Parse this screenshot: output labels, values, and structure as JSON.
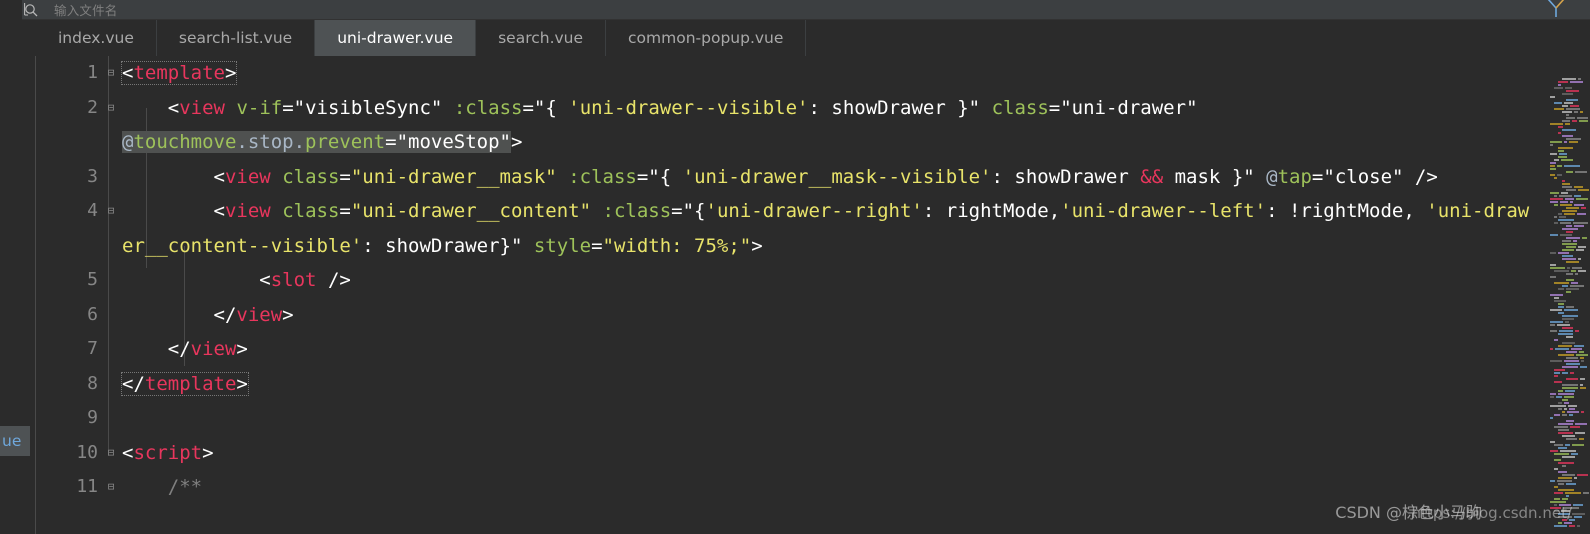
{
  "window": {
    "theme_bg": "#2b2b2b",
    "chrome_bg": "#3c3f41",
    "accent_tag": "#e8365d",
    "accent_attr": "#9ec25a",
    "accent_string": "#e8e36a",
    "active_tab_bg": "#4e5254"
  },
  "search": {
    "icon": "search-icon",
    "placeholder": "输入文件名",
    "value": ""
  },
  "tabs": [
    {
      "label": "index.vue",
      "active": false
    },
    {
      "label": "search-list.vue",
      "active": false
    },
    {
      "label": "uni-drawer.vue",
      "active": true
    },
    {
      "label": "search.vue",
      "active": false
    },
    {
      "label": "common-popup.vue",
      "active": false
    }
  ],
  "editor": {
    "language": "vue",
    "line_numbers": [
      "1",
      "2",
      "3",
      "4",
      "5",
      "6",
      "7",
      "8",
      "9",
      "10",
      "11"
    ],
    "fold_markers": {
      "1": true,
      "2": true,
      "3": false,
      "4": true,
      "5": false,
      "6": false,
      "7": false,
      "8": false,
      "9": false,
      "10": true,
      "11": true
    },
    "lines": {
      "l1": "<template>",
      "l2a": "    <view v-if=\"visibleSync\" :class=\"{ 'uni-drawer--visible': showDrawer }\" class=\"uni-drawer\"",
      "l2b": "@touchmove.stop.prevent=\"moveStop\">",
      "l3a": "        <view class=\"uni-drawer__mask\" :class=\"{ 'uni-drawer__mask--visible': showDrawer && mas",
      "l3b": "k }\" @tap=\"close\" />",
      "l4a": "        <view class=\"uni-drawer__content\" :class=\"{'uni-drawer--right': rightMode,'uni-drawer--",
      "l4b": "left': !rightMode, 'uni-drawer__content--visible': showDrawer}\" style=\"width: 75%;\">",
      "l5": "            <slot />",
      "l6": "        </view>",
      "l7": "    </view>",
      "l8": "</template>",
      "l9": "",
      "l10": "<script>",
      "l11": "    /**"
    },
    "tokens": {
      "tag_template_open": "template",
      "tag_template_close": "/template",
      "tag_view": "view",
      "tag_slot": "slot",
      "tag_script": "script",
      "attr_vif": "v-if",
      "attr_class_bind": ":class",
      "attr_class": "class",
      "attr_touchmove": "touchmove",
      "attr_tap": "tap",
      "attr_style": "style",
      "val_visibleSync": "\"visibleSync\"",
      "val_drawer_visible": "'uni-drawer--visible'",
      "val_showDrawer": "showDrawer",
      "val_uni_drawer": "\"uni-drawer\"",
      "val_moveStop": "\"moveStop\"",
      "val_mask": "\"uni-drawer__mask\"",
      "val_mask_visible": "'uni-drawer__mask--visible'",
      "val_mask_var": "mask",
      "val_close": "\"close\"",
      "val_content": "\"uni-drawer__content\"",
      "val_right": "'uni-drawer--right'",
      "val_rightMode": "rightMode",
      "val_left": "'uni-drawer--left'",
      "val_not_rightMode": "!rightMode",
      "val_content_visible": "'uni-drawer__content--visible'",
      "val_width": "\"width: 75%;\"",
      "op_and": "&&",
      "comment_start": "/**"
    }
  },
  "left_chip": {
    "label": "ue"
  },
  "watermarks": {
    "url": "https://blog.csdn.net/",
    "csdn": "CSDN @棕色小马驹"
  },
  "minimap": {
    "name": "code-minimap",
    "visible": true
  }
}
